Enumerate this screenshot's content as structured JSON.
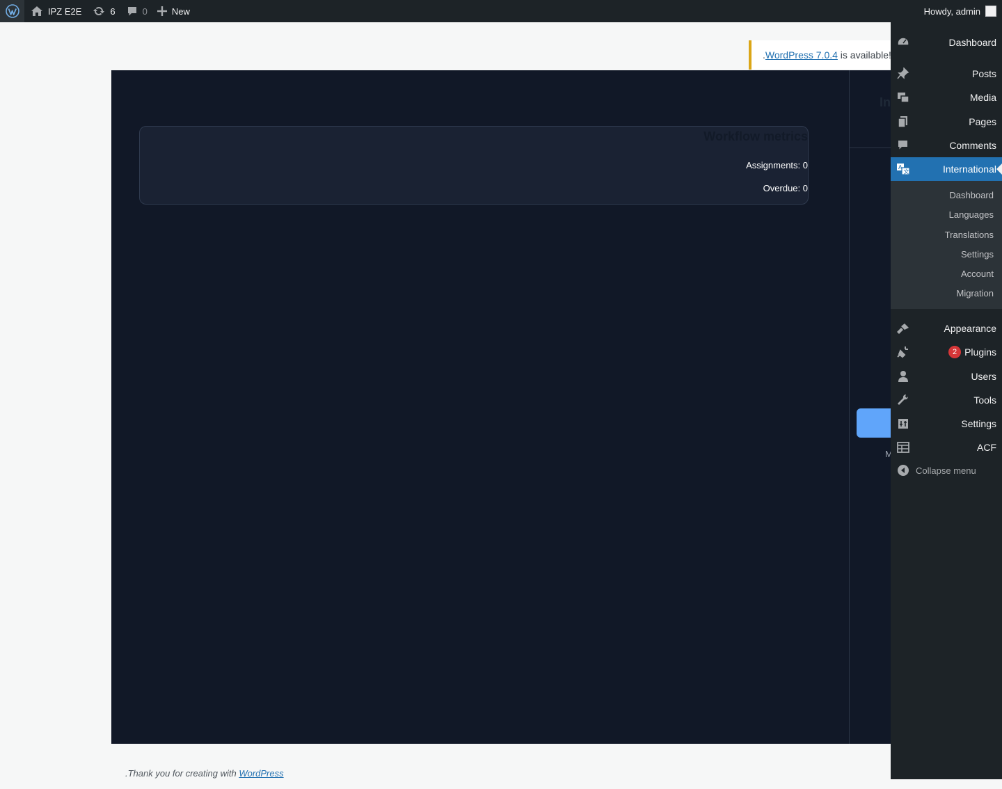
{
  "adminbar": {
    "site_name": "IPZ E2E",
    "updates_count": "6",
    "comments_count": "0",
    "new_label": "New",
    "howdy": "Howdy, admin"
  },
  "notice": {
    "prefix": ".",
    "link_text": "WordPress 7.0.4",
    "suffix": " is available!"
  },
  "app": {
    "metrics_title": "Workflow metrics",
    "assignments": "Assignments: 0",
    "overdue": "Overdue: 0",
    "side_title_peek": "In",
    "side_text_peek": "M"
  },
  "footer": {
    "prefix": ".Thank you for creating with ",
    "link_text": "WordPress"
  },
  "menu": {
    "items": [
      {
        "label": "Dashboard",
        "icon": "dashboard-icon"
      },
      {
        "label": "Posts",
        "icon": "pin-icon"
      },
      {
        "label": "Media",
        "icon": "media-icon"
      },
      {
        "label": "Pages",
        "icon": "pages-icon"
      },
      {
        "label": "Comments",
        "icon": "comment-icon"
      },
      {
        "label": "International",
        "icon": "translation-icon"
      },
      {
        "label": "Appearance",
        "icon": "brush-icon"
      },
      {
        "label": "Plugins",
        "icon": "plugin-icon",
        "badge": "2"
      },
      {
        "label": "Users",
        "icon": "user-icon"
      },
      {
        "label": "Tools",
        "icon": "wrench-icon"
      },
      {
        "label": "Settings",
        "icon": "settings-icon"
      },
      {
        "label": "ACF",
        "icon": "acf-icon"
      }
    ],
    "submenu": [
      "Dashboard",
      "Languages",
      "Translations",
      "Settings",
      "Account",
      "Migration"
    ],
    "collapse_label": "Collapse menu"
  },
  "colors": {
    "adminbar_bg": "#1d2327",
    "menu_current": "#2271b1",
    "app_bg": "#111827",
    "notice_border": "#dba617",
    "badge": "#d63638",
    "button_accent": "#60a5fa"
  }
}
